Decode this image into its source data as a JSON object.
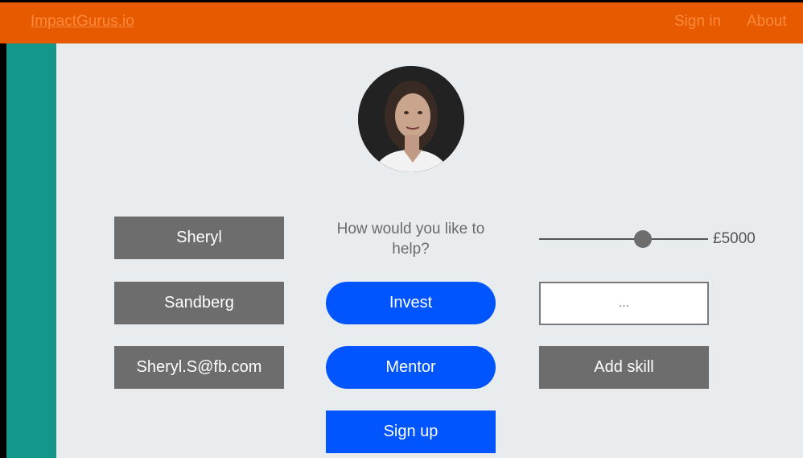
{
  "header": {
    "brand": "ImpactGurus.io",
    "nav": [
      "Sign in",
      "About"
    ]
  },
  "profile": {
    "avatar_alt": "profile photo"
  },
  "form": {
    "first_name": "Sheryl",
    "last_name": "Sandberg",
    "email": "Sheryl.S@fb.com",
    "help_prompt": "How would you like to help?",
    "options": [
      "Invest",
      "Mentor"
    ],
    "signup_label": "Sign up",
    "amount_label": "£5000",
    "amount_fraction": 0.6,
    "skill_input_value": "...",
    "add_skill_label": "Add skill"
  },
  "colors": {
    "topbar": "#e85a00",
    "sidebar": "#14978a",
    "primary": "#0055ff",
    "field_bg": "#6d6d6d",
    "page_bg": "#e9ecee"
  }
}
